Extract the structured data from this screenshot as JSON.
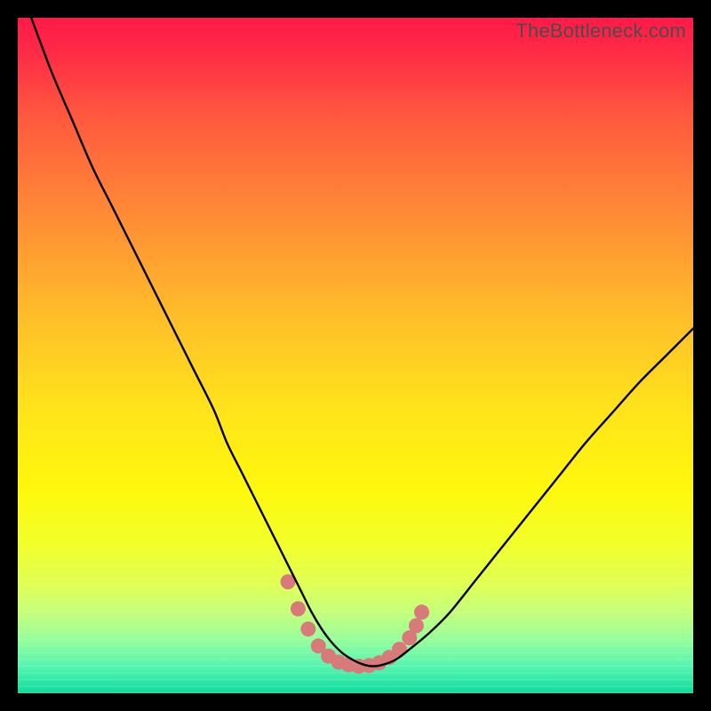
{
  "watermark": "TheBottleneck.com",
  "chart_data": {
    "type": "line",
    "title": "",
    "xlabel": "",
    "ylabel": "",
    "xlim": [
      0,
      100
    ],
    "ylim": [
      0,
      100
    ],
    "grid": false,
    "legend": false,
    "background": {
      "type": "vertical-gradient",
      "stops": [
        {
          "offset": 0.0,
          "color": "#ff1a47"
        },
        {
          "offset": 0.05,
          "color": "#ff2a46"
        },
        {
          "offset": 0.15,
          "color": "#ff5a3e"
        },
        {
          "offset": 0.3,
          "color": "#ff8e35"
        },
        {
          "offset": 0.45,
          "color": "#ffc029"
        },
        {
          "offset": 0.58,
          "color": "#ffe31b"
        },
        {
          "offset": 0.7,
          "color": "#fff80d"
        },
        {
          "offset": 0.78,
          "color": "#f2ff2a"
        },
        {
          "offset": 0.84,
          "color": "#dfff55"
        },
        {
          "offset": 0.88,
          "color": "#c4ff7a"
        },
        {
          "offset": 0.92,
          "color": "#97ff9a"
        },
        {
          "offset": 0.96,
          "color": "#55f5b0"
        },
        {
          "offset": 1.0,
          "color": "#0edc9e"
        }
      ],
      "band_overlay": {
        "start": 0.77,
        "end": 1.0,
        "lines": 24
      }
    },
    "series": [
      {
        "name": "bottleneck-curve",
        "color": "#000000",
        "width": 2.4,
        "x": [
          2,
          5,
          8,
          11,
          14,
          17,
          20,
          23,
          26,
          29,
          31,
          33,
          35,
          37,
          39,
          40.5,
          42,
          43.5,
          45,
          46.5,
          48,
          49.5,
          51,
          52.5,
          54,
          56,
          58,
          61,
          64,
          68,
          72,
          76,
          80,
          84,
          88,
          92,
          96,
          100
        ],
        "y": [
          100,
          92,
          85,
          78,
          72,
          66,
          60,
          54,
          48,
          42,
          37,
          33,
          29,
          25,
          21,
          18,
          15,
          12,
          9.5,
          7.5,
          6,
          5,
          4.3,
          4,
          4.2,
          5,
          6.5,
          9,
          12,
          17,
          22,
          27,
          32,
          37,
          41.5,
          46,
          50,
          54
        ]
      }
    ],
    "markers": {
      "name": "highlight-dots",
      "color": "#d97a7a",
      "radius": 8.5,
      "points": [
        {
          "x": 40.0,
          "y": 16.5
        },
        {
          "x": 41.5,
          "y": 12.5
        },
        {
          "x": 43.0,
          "y": 9.5
        },
        {
          "x": 44.5,
          "y": 7.0
        },
        {
          "x": 46.0,
          "y": 5.5
        },
        {
          "x": 47.5,
          "y": 4.6
        },
        {
          "x": 49.0,
          "y": 4.2
        },
        {
          "x": 50.5,
          "y": 4.0
        },
        {
          "x": 52.0,
          "y": 4.1
        },
        {
          "x": 53.5,
          "y": 4.5
        },
        {
          "x": 55.0,
          "y": 5.3
        },
        {
          "x": 56.5,
          "y": 6.5
        },
        {
          "x": 58.0,
          "y": 8.2
        },
        {
          "x": 59.0,
          "y": 10.0
        },
        {
          "x": 59.8,
          "y": 12.0
        }
      ]
    }
  }
}
